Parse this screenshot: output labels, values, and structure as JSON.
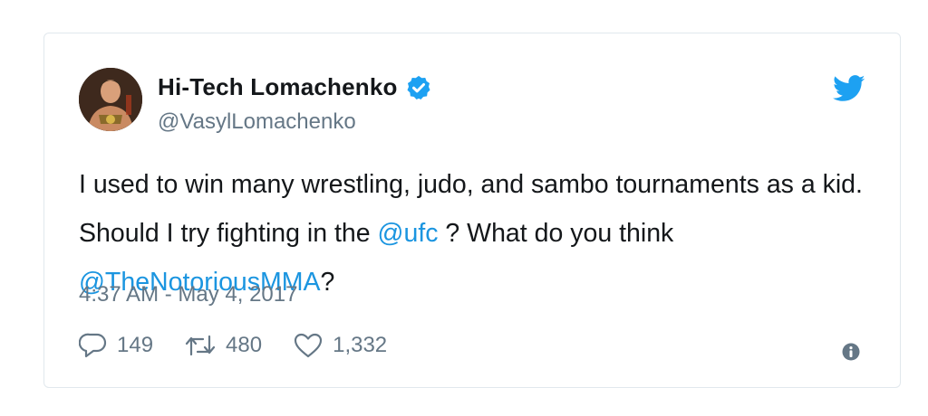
{
  "tweet": {
    "display_name": "Hi-Tech Lomachenko",
    "handle": "@VasylLomachenko",
    "verified": true,
    "avatar_icon": "user-avatar",
    "brand_icon": "twitter-bird-icon",
    "text_parts": [
      "I used to win many wrestling, judo, and sambo tournaments as a kid. Should I try fighting in the ",
      "@ufc",
      " ? What do you think ",
      "@TheNotoriousMMA",
      "?"
    ],
    "timestamp": "4:37 AM - May 4, 2017",
    "replies": "149",
    "retweets": "480",
    "likes": "1,332"
  },
  "colors": {
    "brand_blue": "#1da1f2",
    "mention_blue": "#1b95e0",
    "text": "#14171a",
    "muted": "#657786",
    "border": "#e1e8ed"
  }
}
